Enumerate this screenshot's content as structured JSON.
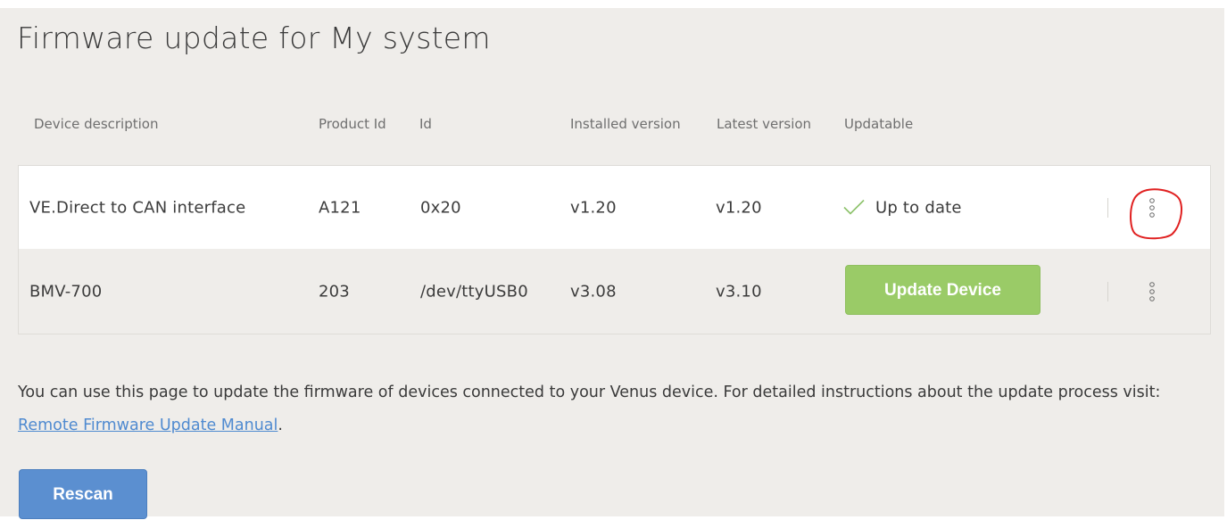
{
  "page": {
    "title": "Firmware update for My system"
  },
  "table": {
    "headers": {
      "description": "Device description",
      "product_id": "Product Id",
      "id": "Id",
      "installed": "Installed version",
      "latest": "Latest version",
      "updatable": "Updatable"
    },
    "rows": [
      {
        "description": "VE.Direct to CAN interface",
        "product_id": "A121",
        "id": "0x20",
        "installed": "v1.20",
        "latest": "v1.20",
        "status": "Up to date",
        "status_icon": "check-icon"
      },
      {
        "description": "BMV-700",
        "product_id": "203",
        "id": "/dev/ttyUSB0",
        "installed": "v3.08",
        "latest": "v3.10",
        "action_label": "Update Device"
      }
    ]
  },
  "info": {
    "text": "You can use this page to update the firmware of devices connected to your Venus device. For detailed instructions about the update process visit: ",
    "link_label": "Remote Firmware Update Manual",
    "suffix": "."
  },
  "actions": {
    "rescan_label": "Rescan"
  },
  "colors": {
    "background": "#efedea",
    "update_button": "#9acb67",
    "rescan_button": "#5b8fd0",
    "link": "#4f8ad0",
    "check": "#8cc26a",
    "annotation": "#e02020"
  }
}
